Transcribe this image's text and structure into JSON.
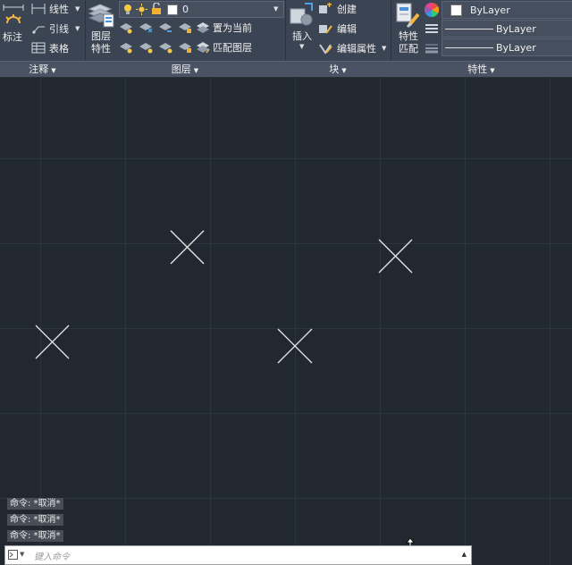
{
  "ribbon": {
    "annotation": {
      "dim_label": "标注",
      "linear_label": "线性",
      "leader_label": "引线",
      "table_label": "表格",
      "footer": "注释"
    },
    "layers": {
      "layer_props_line1": "图层",
      "layer_props_line2": "特性",
      "current_layer": "0",
      "make_current": "置为当前",
      "match_layer": "匹配图层",
      "footer": "图层"
    },
    "block": {
      "insert_label": "插入",
      "create_label": "创建",
      "edit_label": "编辑",
      "edit_attr_label": "编辑属性",
      "footer": "块"
    },
    "properties": {
      "match_line1": "特性",
      "match_line2": "匹配",
      "color": "ByLayer",
      "linetype": "ByLayer",
      "lineweight": "ByLayer",
      "footer": "特性"
    }
  },
  "command": {
    "history": [
      "命令: *取消*",
      "命令: *取消*",
      "命令: *取消*"
    ],
    "placeholder": "键入命令"
  },
  "colors": {
    "canvas_bg": "#212830",
    "ribbon_bg": "#3b4453",
    "marker": "#e6e6e6"
  },
  "icons": {
    "dim": "dimension-icon",
    "insert": "insert-block-icon",
    "match_props": "match-properties-icon",
    "color_wheel": "color-wheel-icon"
  }
}
